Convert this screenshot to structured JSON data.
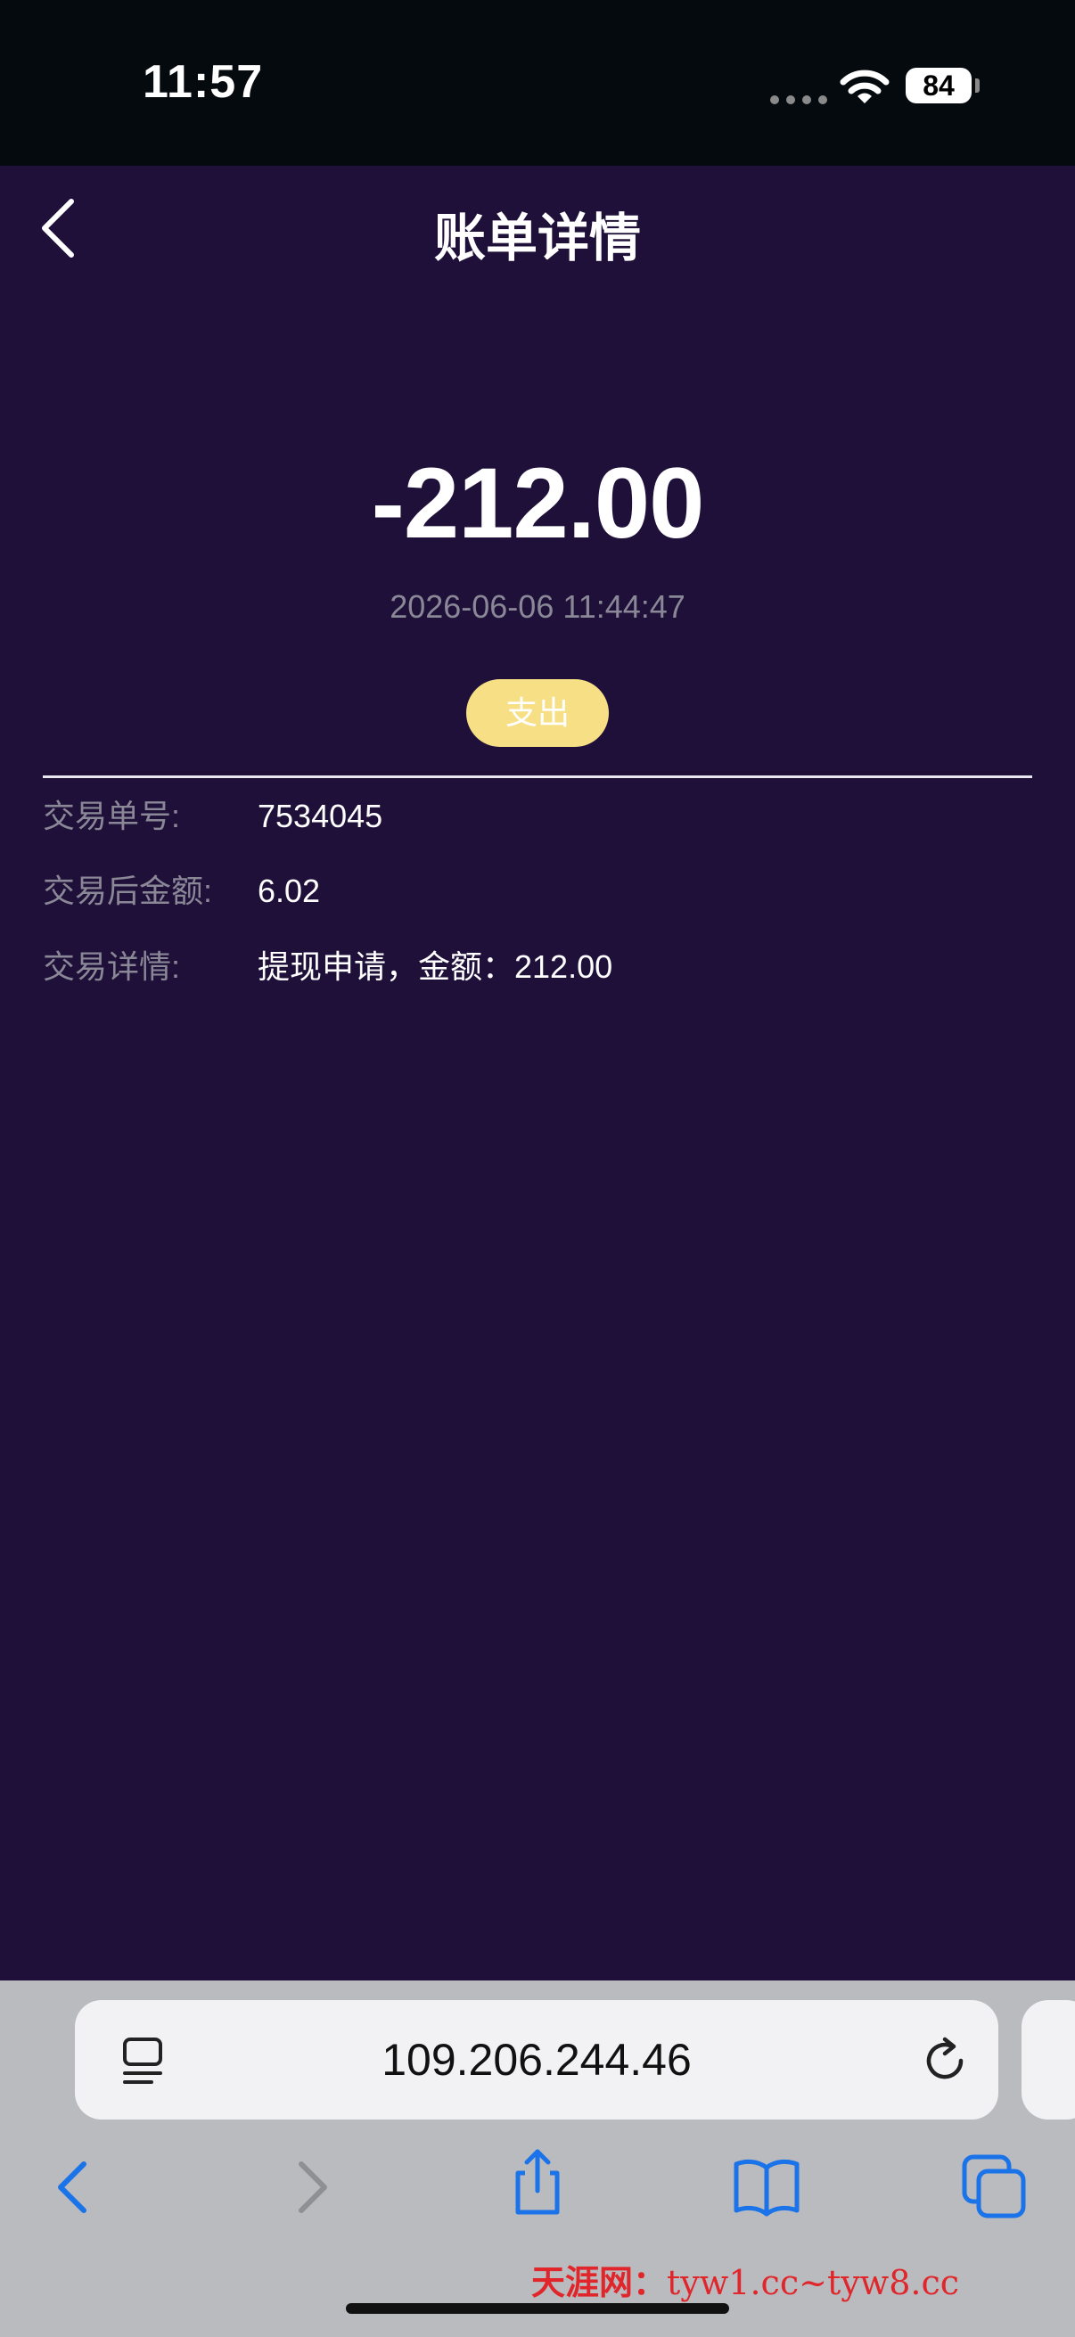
{
  "status_bar": {
    "time": "11:57",
    "battery": "84"
  },
  "header": {
    "title": "账单详情"
  },
  "transaction": {
    "amount": "-212.00",
    "datetime": "2026-06-06 11:44:47",
    "type": "支出"
  },
  "details": [
    {
      "label": "交易单号:",
      "value": "7534045"
    },
    {
      "label": "交易后金额:",
      "value": "6.02"
    },
    {
      "label": "交易详情:",
      "value": "提现申请，金额：212.00"
    }
  ],
  "browser": {
    "url": "109.206.244.46"
  },
  "watermark": {
    "site": "天涯网：",
    "url": "tyw1.cc~tyw8.cc"
  },
  "colors": {
    "background": "#1f103a",
    "badge": "#f7df85",
    "muted_text": "#8a8896",
    "browser_accent": "#1a73e8"
  }
}
